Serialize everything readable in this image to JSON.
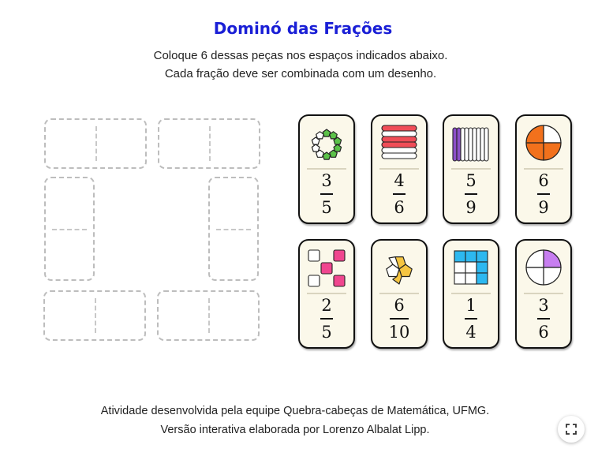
{
  "header": {
    "title": "Dominó das Frações",
    "instruction_line1": "Coloque 6 dessas peças nos espaços indicados abaixo.",
    "instruction_line2": "Cada fração deve ser combinada com um desenho."
  },
  "tiles": [
    {
      "numerator": "3",
      "denominator": "5",
      "picture": "ring of 10 pentagons, 6 green"
    },
    {
      "numerator": "4",
      "denominator": "6",
      "picture": "6 stacked bars, 3 red"
    },
    {
      "numerator": "5",
      "denominator": "9",
      "picture": "9 vertical bars, 2 purple"
    },
    {
      "numerator": "6",
      "denominator": "9",
      "picture": "circle in 4 quarters, 3 orange"
    },
    {
      "numerator": "2",
      "denominator": "5",
      "picture": "5 squares, 3 pink"
    },
    {
      "numerator": "6",
      "denominator": "10",
      "picture": "flower of 5 pentagons, 3 yellow"
    },
    {
      "numerator": "1",
      "denominator": "4",
      "picture": "grid of 9 squares, 5 blue"
    },
    {
      "numerator": "3",
      "denominator": "6",
      "picture": "circle in 4 quarters, 1 purple"
    }
  ],
  "colors": {
    "title": "#1a1fd6",
    "green": "#5cc249",
    "red": "#f04d57",
    "purple": "#8c4fc8",
    "orange": "#f2711c",
    "pink": "#f0468f",
    "yellow": "#f5c542",
    "blue": "#2db8f0",
    "light_purple": "#c77ef0",
    "tile_bg": "#fbf8ea"
  },
  "footer": {
    "line1": "Atividade desenvolvida pela equipe Quebra-cabeças de Matemática, UFMG.",
    "line2": "Versão interativa elaborada por Lorenzo Albalat Lipp."
  },
  "controls": {
    "fullscreen_icon": "fullscreen-icon"
  }
}
